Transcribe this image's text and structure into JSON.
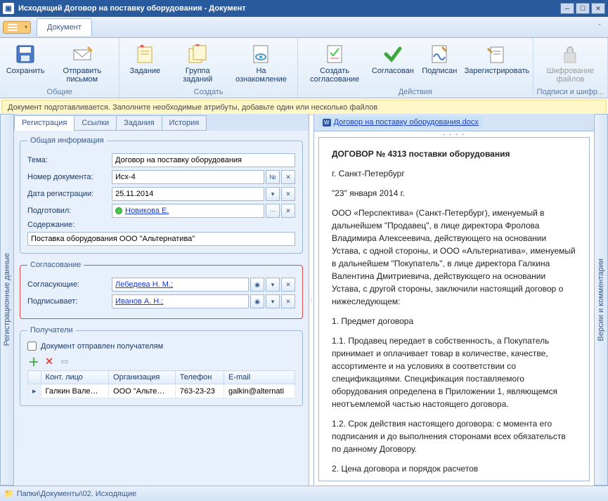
{
  "window": {
    "title": "Исходящий Договор на поставку оборудования - Документ"
  },
  "menubar": {
    "tab": "Документ"
  },
  "ribbon": {
    "groups": [
      {
        "label": "Общие",
        "items": [
          {
            "key": "save",
            "label": "Сохранить"
          },
          {
            "key": "send",
            "label": "Отправить письмом"
          }
        ]
      },
      {
        "label": "Создать",
        "items": [
          {
            "key": "task",
            "label": "Задание"
          },
          {
            "key": "taskgroup",
            "label": "Группа заданий"
          },
          {
            "key": "review",
            "label": "На ознакомление"
          }
        ]
      },
      {
        "label": "Действия",
        "items": [
          {
            "key": "createapprove",
            "label": "Создать согласование"
          },
          {
            "key": "approved",
            "label": "Согласован"
          },
          {
            "key": "signed",
            "label": "Подписан"
          },
          {
            "key": "register",
            "label": "Зарегистрировать"
          }
        ]
      },
      {
        "label": "Подписи и шифр...",
        "items": [
          {
            "key": "encrypt",
            "label": "Шифрование файлов",
            "disabled": true
          }
        ]
      }
    ]
  },
  "infobar": "Документ подготавливается. Заполните необходимые атрибуты, добавьте один или несколько файлов",
  "side_tabs": {
    "left": "Регистрационные данные",
    "right": "Версии и комментарии"
  },
  "tabs": [
    "Регистрация",
    "Ссылки",
    "Задания",
    "История"
  ],
  "form": {
    "general": {
      "legend": "Общая информация",
      "topic_label": "Тема:",
      "topic": "Договор на поставку оборудования",
      "docnum_label": "Номер документа:",
      "docnum": "Исх-4",
      "docnum_btn": "№",
      "date_label": "Дата регистрации:",
      "date": "25.11.2014",
      "prepared_label": "Подготовил:",
      "prepared": "Новикова Е.",
      "content_label": "Содержание:",
      "content": "Поставка оборудования ООО \"Альтернатива\""
    },
    "approval": {
      "legend": "Согласование",
      "approvers_label": "Согласующие:",
      "approvers": "Лебедева Н. М.; ",
      "signer_label": "Подписывает:",
      "signer": "Иванов А. Н.; "
    },
    "recipients": {
      "legend": "Получатели",
      "sent_checkbox": "Документ отправлен получателям",
      "columns": [
        "Конт. лицо",
        "Организация",
        "Телефон",
        "E-mail"
      ],
      "rows": [
        {
          "contact": "Галкин Вале…",
          "org": "ООО \"Альте…",
          "phone": "763-23-23",
          "email": "galkin@alternati"
        }
      ]
    }
  },
  "file": {
    "name": "Договор на поставку оборудования.docx"
  },
  "doc": {
    "title": "ДОГОВОР № 4313 поставки оборудования",
    "city": "г. Санкт-Петербург",
    "date": "\"23\" января 2014 г.",
    "p1": "ООО «Перспектива» (Санкт-Петербург), именуемый в дальнейшем \"Продавец\", в лице директора Фролова Владимира Алексеевича, действующего на основании Устава, с одной стороны, и ООО «Альтернатива», именуемый в дальнейшем \"Покупатель\", в лице директора Галкина Валентина Дмитриевича, действующего на основании Устава, с другой стороны, заключили настоящий договор о нижеследующем:",
    "s1": "1. Предмет договора",
    "p2": "1.1. Продавец передает в собственность, а Покупатель принимает и оплачивает товар в количестве, качестве, ассортименте и на условиях в соответствии со спецификациями. Спецификация поставляемого оборудования определена в Приложении 1, являющемся неотъемлемой частью настоящего договора.",
    "p3": "1.2. Срок действия настоящего договора: с момента его подписания и до выполнения сторонами всех обязательств по данному Договору.",
    "s2": "2. Цена договора и порядок расчетов"
  },
  "statusbar": "Папки\\Документы\\02. Исходящие"
}
